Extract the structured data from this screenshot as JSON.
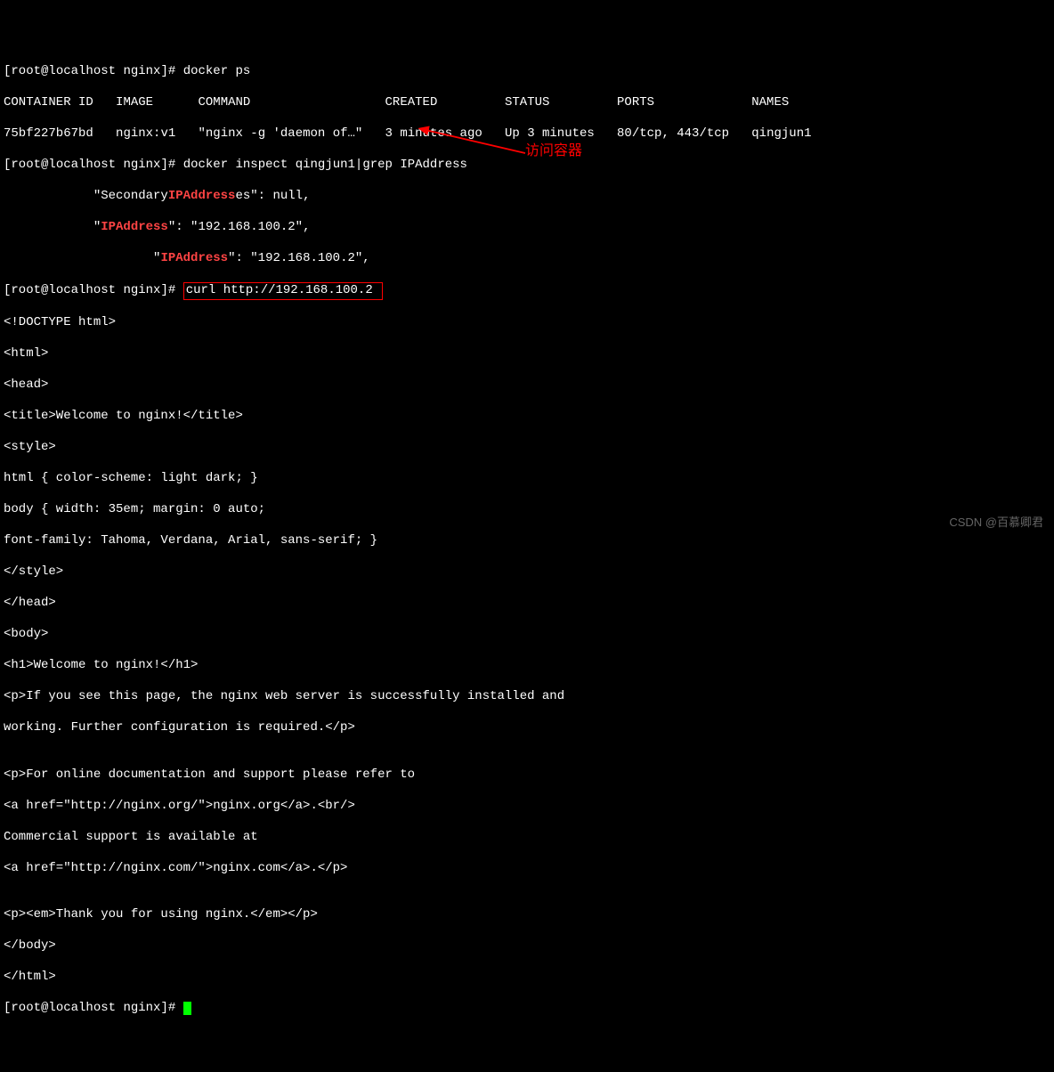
{
  "prompt": {
    "user": "root",
    "at": "@",
    "host": "localhost",
    "dir": "nginx",
    "open": "[",
    "close": "]#",
    "space": " "
  },
  "commands": {
    "docker_ps": "docker ps",
    "docker_inspect": "docker inspect qingjun1|grep IPAddress",
    "curl": "curl http://192.168.100.2"
  },
  "ps_header": {
    "container_id": "CONTAINER ID",
    "image": "IMAGE",
    "command": "COMMAND",
    "created": "CREATED",
    "status": "STATUS",
    "ports": "PORTS",
    "names": "NAMES"
  },
  "ps_row": {
    "container_id": "75bf227b67bd",
    "image": "nginx:v1",
    "command": "\"nginx -g 'daemon of…\"",
    "created": "3 minutes ago",
    "status": "Up 3 minutes",
    "ports": "80/tcp, 443/tcp",
    "names": "qingjun1"
  },
  "inspect": {
    "l1_pre": "            \"Secondary",
    "l1_hl": "IPAddress",
    "l1_post": "es\": null,",
    "l2_pre": "            \"",
    "l2_hl": "IPAddress",
    "l2_post": "\": \"192.168.100.2\",",
    "l3_pre": "                    \"",
    "l3_hl": "IPAddress",
    "l3_post": "\": \"192.168.100.2\","
  },
  "curl_output": {
    "l01": "<!DOCTYPE html>",
    "l02": "<html>",
    "l03": "<head>",
    "l04": "<title>Welcome to nginx!</title>",
    "l05": "<style>",
    "l06": "html { color-scheme: light dark; }",
    "l07": "body { width: 35em; margin: 0 auto;",
    "l08": "font-family: Tahoma, Verdana, Arial, sans-serif; }",
    "l09": "</style>",
    "l10": "</head>",
    "l11": "<body>",
    "l12": "<h1>Welcome to nginx!</h1>",
    "l13": "<p>If you see this page, the nginx web server is successfully installed and",
    "l14": "working. Further configuration is required.</p>",
    "l15": "",
    "l16": "<p>For online documentation and support please refer to",
    "l17": "<a href=\"http://nginx.org/\">nginx.org</a>.<br/>",
    "l18": "Commercial support is available at",
    "l19": "<a href=\"http://nginx.com/\">nginx.com</a>.</p>",
    "l20": "",
    "l21": "<p><em>Thank you for using nginx.</em></p>",
    "l22": "</body>",
    "l23": "</html>"
  },
  "annotation": "访问容器",
  "watermark": "CSDN @百慕卿君"
}
